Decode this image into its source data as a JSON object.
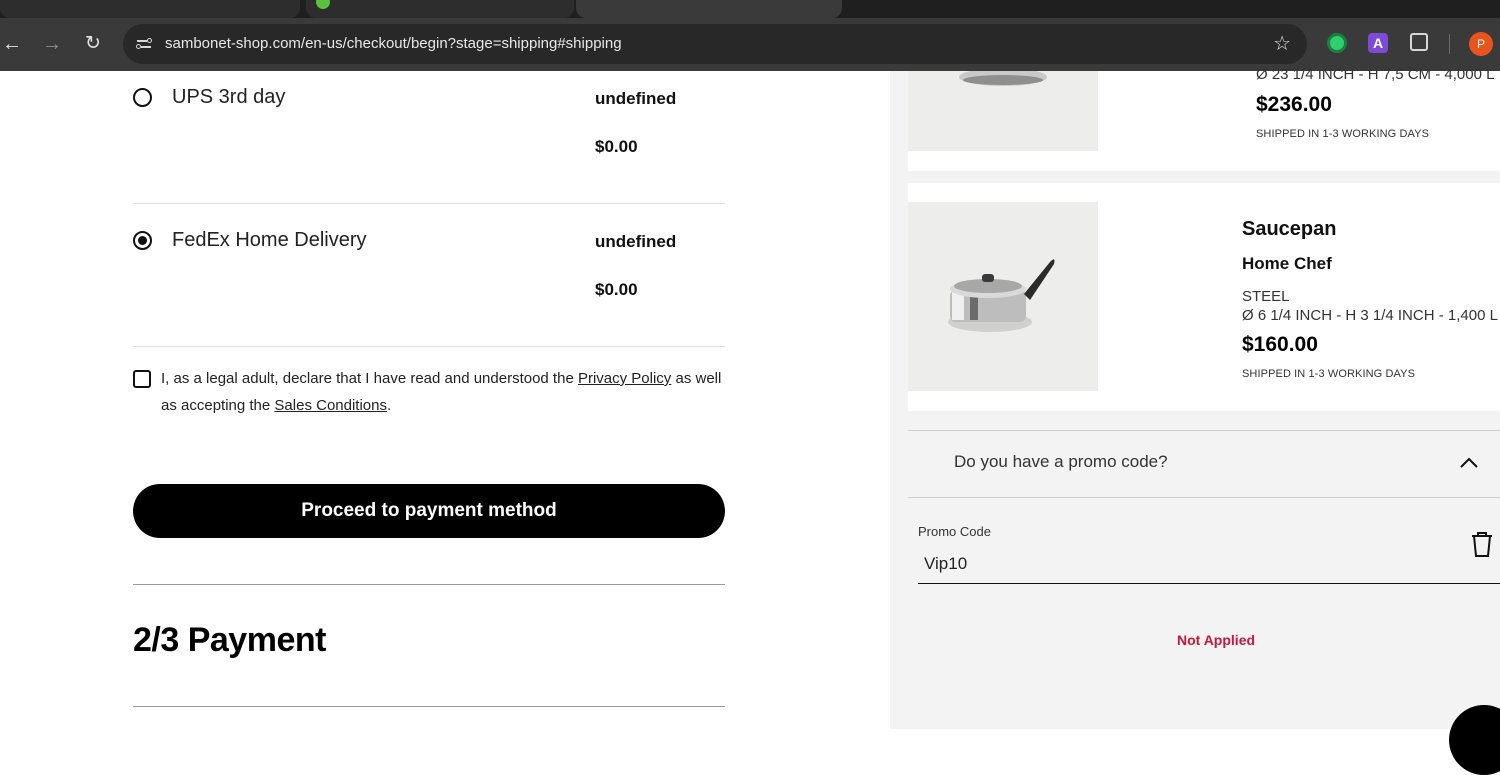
{
  "browser": {
    "url": "sambonet-shop.com/en-us/checkout/begin?stage=shipping#shipping",
    "profile_initial": "P",
    "extension_letter": "A"
  },
  "shipping": {
    "options": [
      {
        "name": "UPS 3rd day",
        "eta": "undefined",
        "price": "$0.00",
        "selected": false
      },
      {
        "name": "FedEx Home Delivery",
        "eta": "undefined",
        "price": "$0.00",
        "selected": true
      }
    ],
    "consent_prefix": "I, as a legal adult, declare that I have read and understood the ",
    "privacy_link": "Privacy Policy",
    "consent_middle": " as well as accepting the ",
    "sales_link": "Sales Conditions",
    "consent_suffix": ".",
    "proceed_label": "Proceed to payment method"
  },
  "payment": {
    "step_title": "2/3 Payment"
  },
  "cart": {
    "items": [
      {
        "dimensions": "Ø 23 1/4 INCH - H 7,5 CM - 4,000 L",
        "price": "$236.00",
        "shipping_note": "SHIPPED IN 1-3 WORKING DAYS"
      },
      {
        "name": "Saucepan",
        "line": "Home Chef",
        "material": "STEEL",
        "dimensions": "Ø 6 1/4 INCH - H 3 1/4 INCH - 1,400 L",
        "price": "$160.00",
        "shipping_note": "SHIPPED IN 1-3 WORKING DAYS"
      }
    ],
    "promo": {
      "question": "Do you have a promo code?",
      "label": "Promo Code",
      "value": "Vip10",
      "status": "Not Applied",
      "status_color": "#c4183c"
    }
  }
}
